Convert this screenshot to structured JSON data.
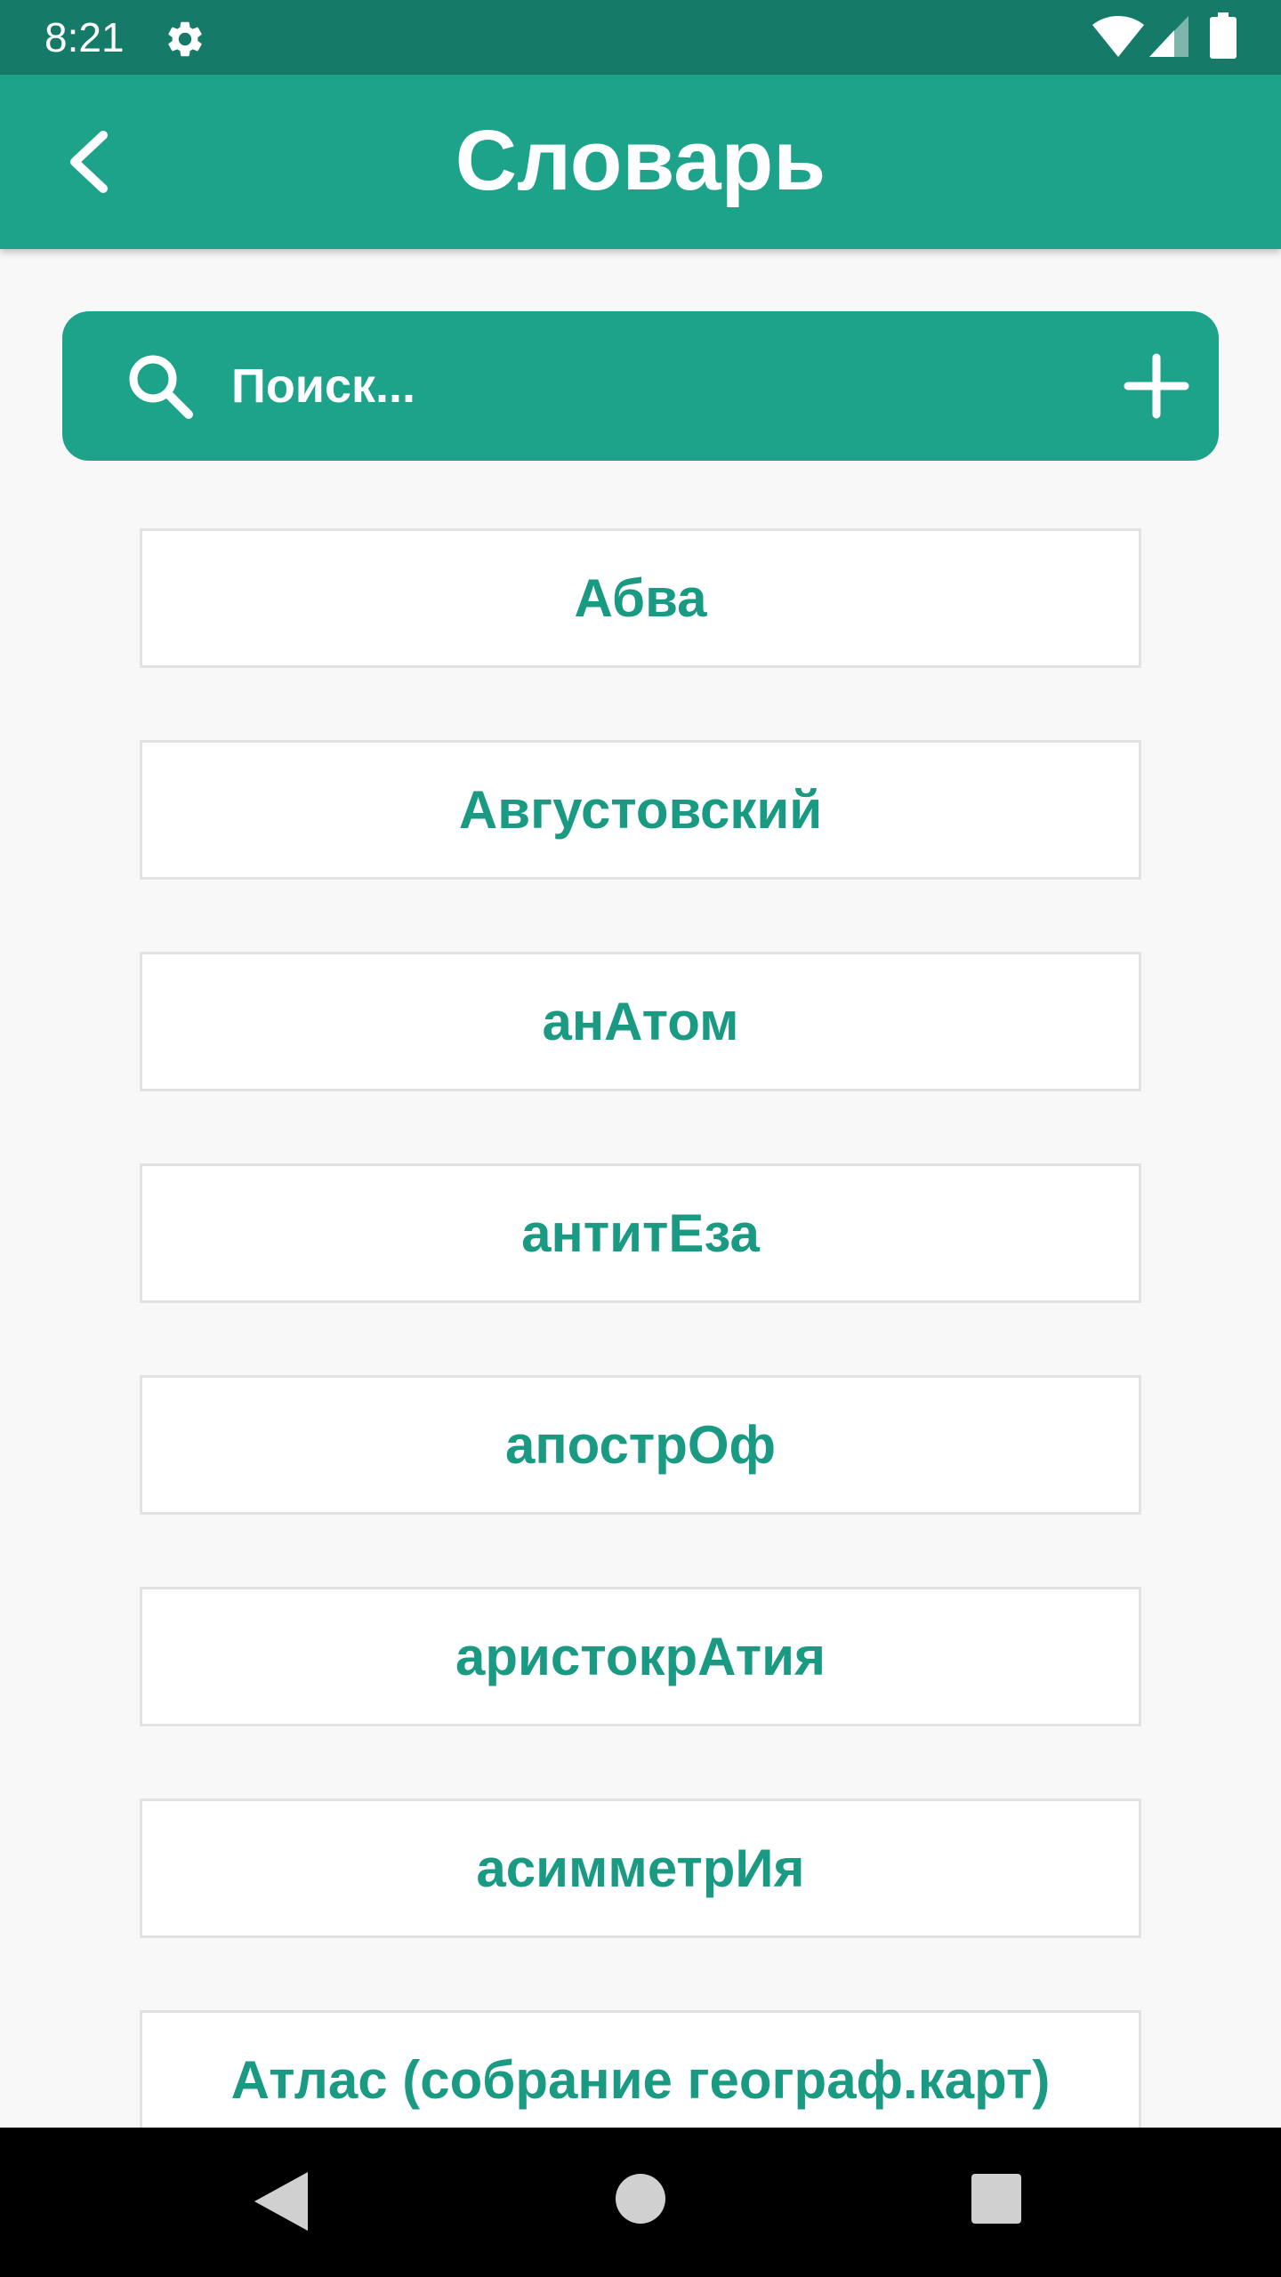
{
  "status_bar": {
    "time": "8:21",
    "icons": [
      "gear-icon",
      "wifi-icon",
      "signal-icon",
      "battery-icon"
    ]
  },
  "app_bar": {
    "title": "Словарь",
    "back_icon": "chevron-left-icon"
  },
  "search": {
    "placeholder": "Поиск...",
    "value": "",
    "search_icon": "search-icon",
    "add_icon": "plus-icon"
  },
  "words": [
    {
      "label": "Абва"
    },
    {
      "label": "Августовский"
    },
    {
      "label": "анАтом"
    },
    {
      "label": "антитЕза"
    },
    {
      "label": "апострОф"
    },
    {
      "label": "аристокрАтия"
    },
    {
      "label": "асимметрИя"
    },
    {
      "label": "Атлас (собрание географ.карт)"
    }
  ],
  "nav_bar": {
    "icons": [
      "nav-back-icon",
      "nav-home-icon",
      "nav-recents-icon"
    ]
  },
  "colors": {
    "status_bar": "#167a68",
    "primary": "#1ca38a",
    "word_text": "#1a9a82",
    "background": "#f8f8f8",
    "card_border": "#e2e2e2"
  }
}
